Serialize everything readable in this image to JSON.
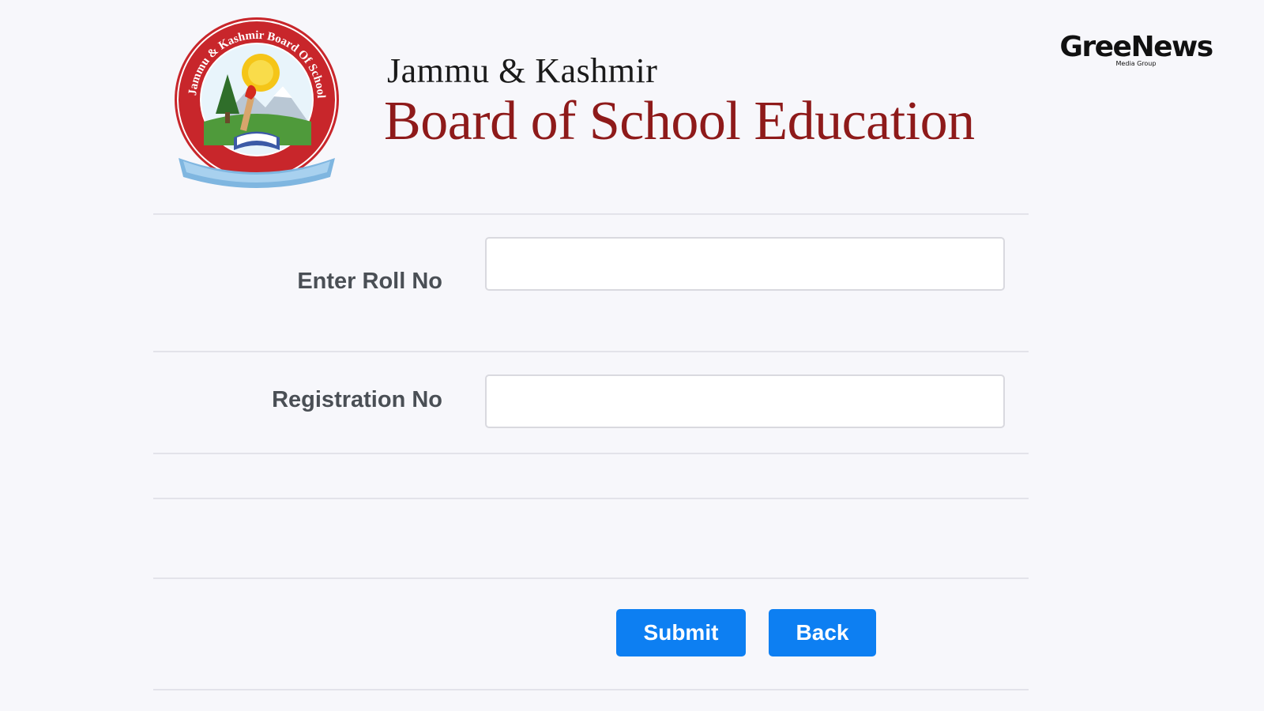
{
  "header": {
    "logo_ring_text": "Jammu & Kashmir Board Of School Education",
    "title_small": "Jammu & Kashmir",
    "title_big": "Board of School Education"
  },
  "brand": {
    "name": "GreeNews",
    "subtitle": "Media Group"
  },
  "form": {
    "roll_label": "Enter Roll No",
    "roll_value": "",
    "registration_label": "Registration No",
    "registration_value": "",
    "submit_label": "Submit",
    "back_label": "Back"
  },
  "colors": {
    "background": "#f7f7fb",
    "title_red": "#8e1a1a",
    "button_blue": "#0d7ff2",
    "label_gray": "#4a4f55"
  }
}
